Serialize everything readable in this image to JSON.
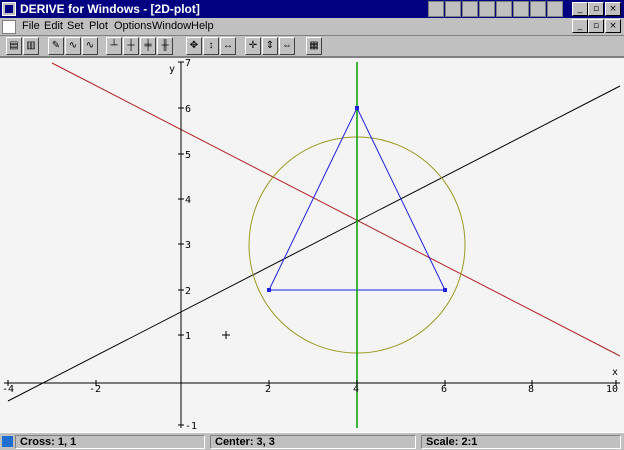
{
  "window": {
    "title": "DERIVE for Windows - [2D-plot]"
  },
  "menu": {
    "items": [
      "File",
      "Edit",
      "Set",
      "Plot",
      "Options",
      "Window",
      "Help"
    ]
  },
  "plot": {
    "y_axis_label": "y",
    "x_axis_label": "x",
    "x_tick_labels": [
      "-4",
      "-2",
      "2",
      "4",
      "6",
      "8",
      "10"
    ],
    "y_tick_labels": [
      "-1",
      "1",
      "2",
      "3",
      "4",
      "5",
      "6",
      "7"
    ],
    "colors": {
      "red_line": "#b22222",
      "black_line": "#000000",
      "green_line": "#00a000",
      "circle": "#9a9a20",
      "triangle": "#2020e0",
      "background": "#f4f4f4"
    }
  },
  "status": {
    "cross": "Cross: 1, 1",
    "center": "Center: 3, 3",
    "scale": "Scale: 2:1"
  }
}
